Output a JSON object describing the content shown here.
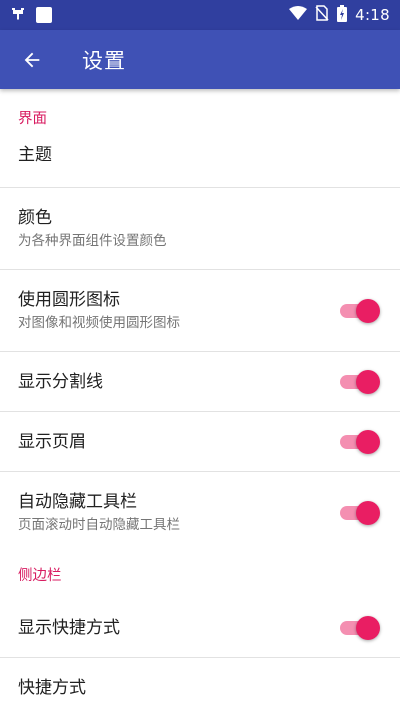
{
  "statusbar": {
    "time": "4:18",
    "icons": [
      "bug-icon",
      "square-icon",
      "wifi-icon",
      "no-sim-icon",
      "battery-charging-icon"
    ]
  },
  "appbar": {
    "title": "设置",
    "back_icon": "arrow-left-icon"
  },
  "sections": [
    {
      "header": "界面",
      "items": [
        {
          "title": "主题"
        },
        {
          "title": "颜色",
          "subtitle": "为各种界面组件设置颜色"
        },
        {
          "title": "使用圆形图标",
          "subtitle": "对图像和视频使用圆形图标",
          "toggle": true
        },
        {
          "title": "显示分割线",
          "toggle": true
        },
        {
          "title": "显示页眉",
          "toggle": true
        },
        {
          "title": "自动隐藏工具栏",
          "subtitle": "页面滚动时自动隐藏工具栏",
          "toggle": true
        }
      ]
    },
    {
      "header": "侧边栏",
      "items": [
        {
          "title": "显示快捷方式",
          "toggle": true
        },
        {
          "title": "快捷方式"
        }
      ]
    }
  ],
  "colors": {
    "statusbar": "#303f9f",
    "appbar": "#3f51b5",
    "accent": "#e91e63",
    "section_header": "#d81b60"
  }
}
